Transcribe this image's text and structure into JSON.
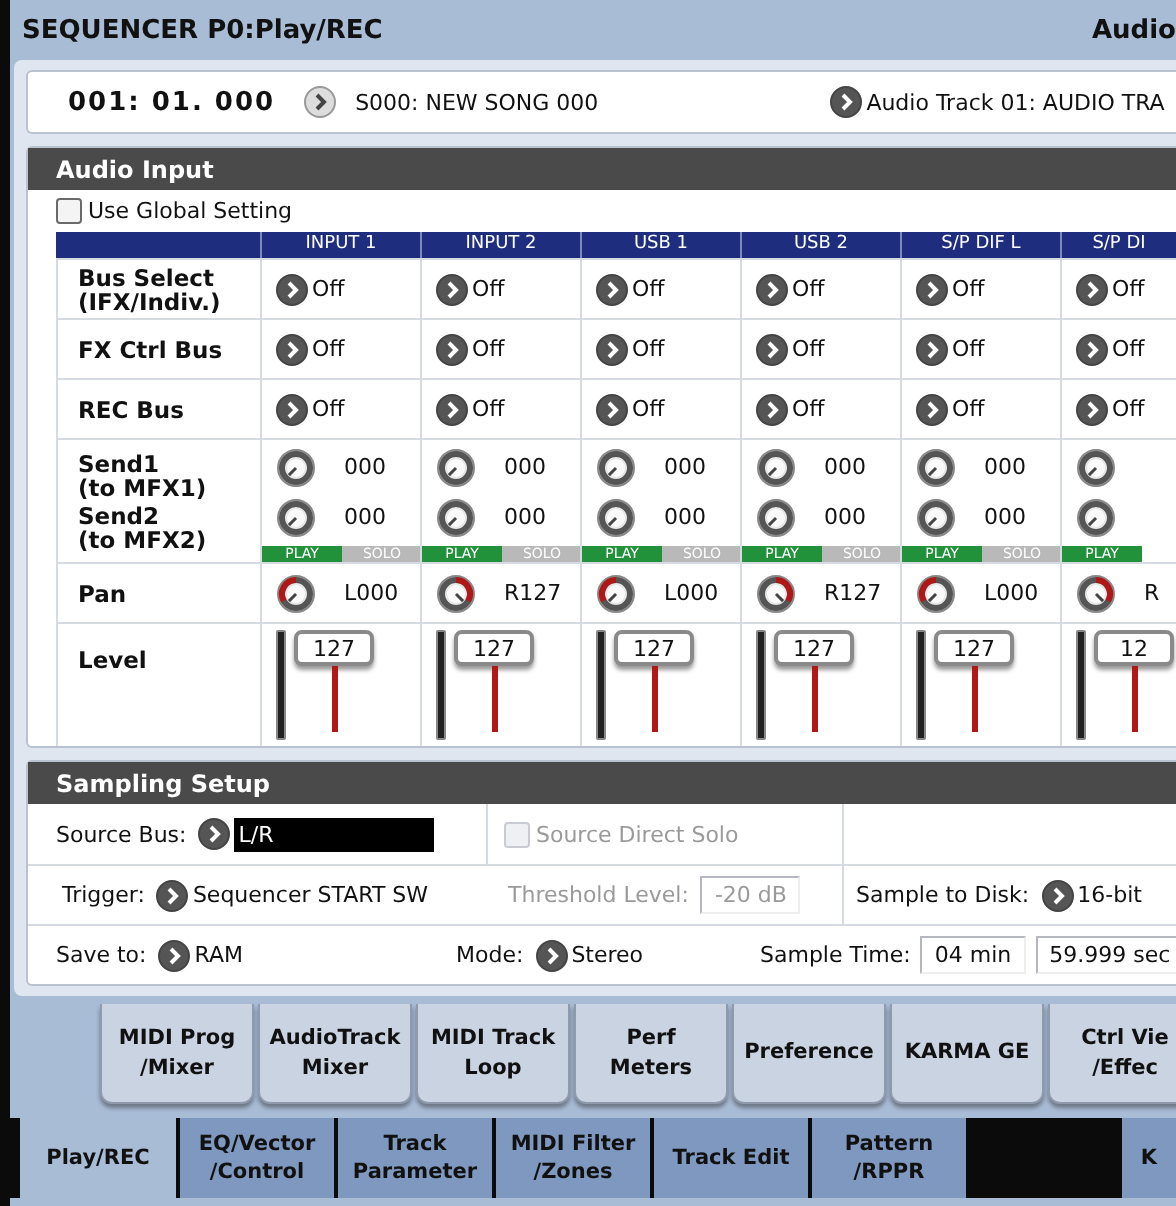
{
  "header": {
    "title": "SEQUENCER P0:Play/REC",
    "page_title": "Audio"
  },
  "locator": {
    "position": "001: 01. 000",
    "song": "S000: NEW SONG 000",
    "track": "Audio Track 01: AUDIO TRA"
  },
  "audio_input": {
    "title": "Audio Input",
    "use_global_setting": {
      "label": "Use Global Setting",
      "checked": false
    },
    "row_labels": {
      "bus_select": "Bus Select\n(IFX/Indiv.)",
      "fx_ctrl_bus": "FX Ctrl Bus",
      "rec_bus": "REC Bus",
      "send1": "Send1\n(to MFX1)",
      "send2": "Send2\n(to MFX2)",
      "pan": "Pan",
      "level": "Level"
    },
    "channels": [
      {
        "name": "INPUT 1",
        "bus_select": "Off",
        "fx_ctrl_bus": "Off",
        "rec_bus": "Off",
        "send1": "000",
        "send2": "000",
        "modes": [
          {
            "label": "PLAY",
            "selected": true
          },
          {
            "label": "SOLO",
            "selected": false
          }
        ],
        "pan": {
          "reading": "L000",
          "right": false
        },
        "fader": "127"
      },
      {
        "name": "INPUT 2",
        "bus_select": "Off",
        "fx_ctrl_bus": "Off",
        "rec_bus": "Off",
        "send1": "000",
        "send2": "000",
        "modes": [
          {
            "label": "PLAY",
            "selected": true
          },
          {
            "label": "SOLO",
            "selected": false
          }
        ],
        "pan": {
          "reading": "R127",
          "right": true
        },
        "fader": "127"
      },
      {
        "name": "USB 1",
        "bus_select": "Off",
        "fx_ctrl_bus": "Off",
        "rec_bus": "Off",
        "send1": "000",
        "send2": "000",
        "modes": [
          {
            "label": "PLAY",
            "selected": true
          },
          {
            "label": "SOLO",
            "selected": false
          }
        ],
        "pan": {
          "reading": "L000",
          "right": false
        },
        "fader": "127"
      },
      {
        "name": "USB 2",
        "bus_select": "Off",
        "fx_ctrl_bus": "Off",
        "rec_bus": "Off",
        "send1": "000",
        "send2": "000",
        "modes": [
          {
            "label": "PLAY",
            "selected": true
          },
          {
            "label": "SOLO",
            "selected": false
          }
        ],
        "pan": {
          "reading": "R127",
          "right": true
        },
        "fader": "127"
      },
      {
        "name": "S/P DIF L",
        "bus_select": "Off",
        "fx_ctrl_bus": "Off",
        "rec_bus": "Off",
        "send1": "000",
        "send2": "000",
        "modes": [
          {
            "label": "PLAY",
            "selected": true
          },
          {
            "label": "SOLO",
            "selected": false
          }
        ],
        "pan": {
          "reading": "L000",
          "right": false
        },
        "fader": "127"
      },
      {
        "name": "S/P DI",
        "bus_select": "Off",
        "fx_ctrl_bus": "Off",
        "rec_bus": "Off",
        "modes": [
          {
            "label": "PLAY",
            "selected": true
          }
        ],
        "pan": {
          "reading": "R",
          "right": true
        },
        "fader": "12"
      }
    ]
  },
  "sampling_setup": {
    "title": "Sampling Setup",
    "source_bus": {
      "label": "Source Bus:",
      "value": "L/R"
    },
    "source_direct_solo": {
      "label": "Source Direct Solo",
      "checked": false,
      "disabled": true
    },
    "trigger": {
      "label": "Trigger:",
      "value": "Sequencer START SW"
    },
    "threshold_level": {
      "label": "Threshold Level:",
      "value": "-20 dB",
      "disabled": true
    },
    "sample_to_disk": {
      "label": "Sample to Disk:",
      "value": "16-bit"
    },
    "save_to": {
      "label": "Save to:",
      "value": "RAM"
    },
    "mode": {
      "label": "Mode:",
      "value": "Stereo"
    },
    "sample_time": {
      "label": "Sample Time:",
      "minutes": "04 min",
      "seconds": "59.999 sec"
    }
  },
  "upper_tabs": [
    {
      "label": "MIDI Prog\n/Mixer"
    },
    {
      "label": "AudioTrack\nMixer"
    },
    {
      "label": "MIDI Track\nLoop"
    },
    {
      "label": "Perf\nMeters"
    },
    {
      "label": "Preference"
    },
    {
      "label": "KARMA GE"
    },
    {
      "label": "Ctrl Vie\n/Effec"
    }
  ],
  "page_tabs": [
    {
      "label": "Play/REC",
      "selected": true
    },
    {
      "label": "EQ/Vector\n/Control",
      "selected": false
    },
    {
      "label": "Track\nParameter",
      "selected": false
    },
    {
      "label": "MIDI Filter\n/Zones",
      "selected": false
    },
    {
      "label": "Track Edit",
      "selected": false
    },
    {
      "label": "Pattern\n/RPPR",
      "selected": false
    },
    {
      "label": "K",
      "selected": false
    }
  ]
}
